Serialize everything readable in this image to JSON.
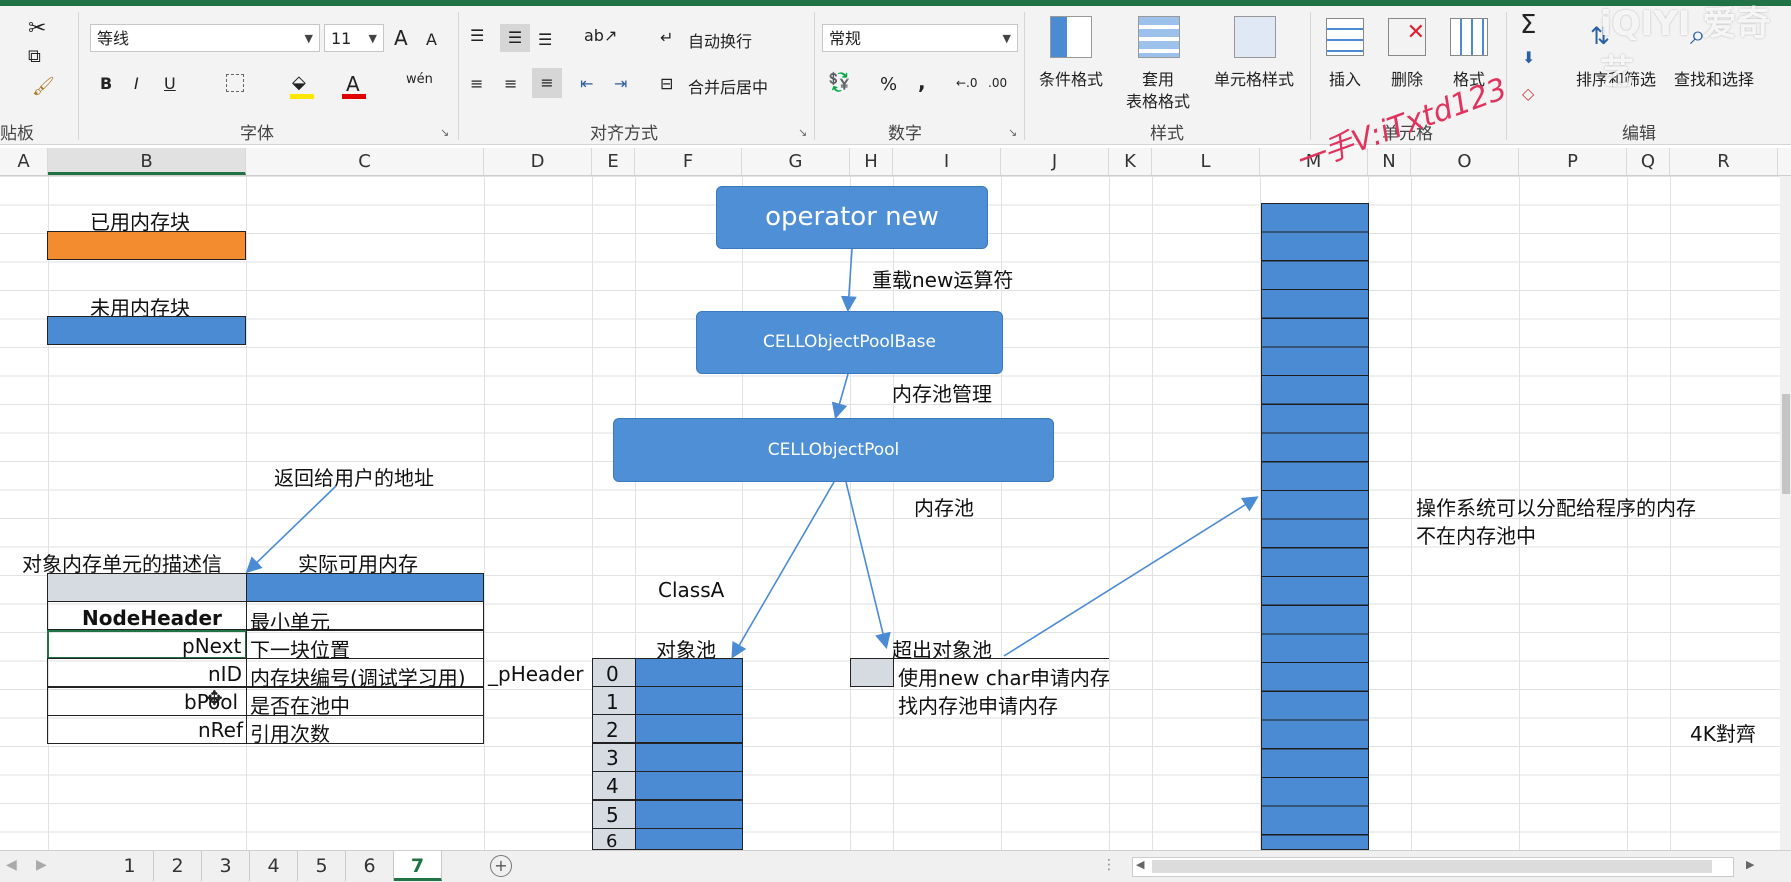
{
  "ribbon": {
    "clipboard": {
      "label": "贴板"
    },
    "font": {
      "label": "字体",
      "font_name": "等线",
      "font_size": "11",
      "bold": "B",
      "italic": "I",
      "underline": "U",
      "grow": "A",
      "shrink": "A",
      "phonetic": "wén"
    },
    "alignment": {
      "label": "对齐方式",
      "wrap_text": "自动换行",
      "merge_center": "合并后居中"
    },
    "number": {
      "label": "数字",
      "format": "常规",
      "percent": "%",
      "comma": ","
    },
    "styles": {
      "label": "样式",
      "conditional": "条件格式",
      "table_line1": "套用",
      "table_line2": "表格格式",
      "cell_styles": "单元格样式"
    },
    "cells": {
      "label": "单元格",
      "insert": "插入",
      "delete": "删除",
      "format": "格式"
    },
    "editing": {
      "label": "编辑",
      "sigma": "Σ",
      "sort": "排序和筛选",
      "find": "查找和选择"
    }
  },
  "watermark": {
    "brand": "iQIYI 爱奇艺",
    "handwritten": "一手V:iTxtd123"
  },
  "columns": [
    "A",
    "B",
    "C",
    "D",
    "E",
    "F",
    "G",
    "H",
    "I",
    "J",
    "K",
    "L",
    "M",
    "N",
    "O",
    "P",
    "Q",
    "R"
  ],
  "legend": {
    "used": "已用内存块",
    "unused": "未用内存块"
  },
  "table": {
    "desc_header": "对象内存单元的描述信",
    "actual_header": "实际可用内存",
    "return_label": "返回给用户的地址",
    "rows": [
      {
        "name": "NodeHeader",
        "desc": "最小单元"
      },
      {
        "name": "pNext",
        "desc": "下一块位置"
      },
      {
        "name": "nID",
        "desc": "内存块编号(调试学习用)"
      },
      {
        "name": "bPool",
        "desc": "是否在池中"
      },
      {
        "name": "nRef",
        "desc": "引用次数"
      }
    ],
    "pheader": "_pHeader"
  },
  "flow": {
    "operator_new": "operator new",
    "overload_label": "重载new运算符",
    "pool_base": "CELLObjectPoolBase",
    "pool_mgmt_label": "内存池管理",
    "pool": "CELLObjectPool",
    "mem_pool_label": "内存池",
    "classA": "ClassA",
    "object_pool": "对象池",
    "indices": [
      "0",
      "1",
      "2",
      "3",
      "4",
      "5",
      "6"
    ],
    "overflow": "超出对象池",
    "use_new_char": "使用new char申请内存",
    "find_pool": "找内存池申请内存"
  },
  "os_note": {
    "line1": "操作系统可以分配给程序的内存",
    "line2": "不在内存池中"
  },
  "align_note": "4K對齊",
  "sheets": {
    "tabs": [
      "1",
      "2",
      "3",
      "4",
      "5",
      "6",
      "7"
    ],
    "active": "7"
  },
  "colors": {
    "accent_green": "#217346",
    "block_blue": "#4a8bd3",
    "block_orange": "#f28c2f"
  }
}
